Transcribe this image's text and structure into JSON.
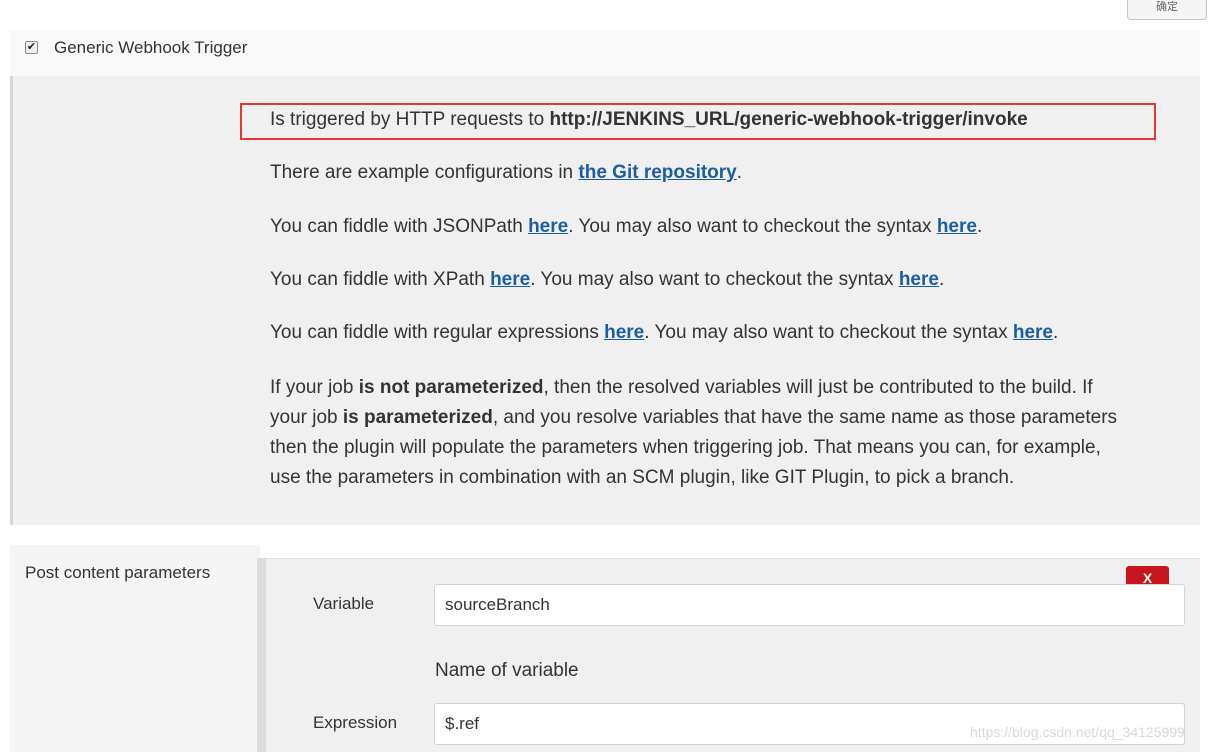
{
  "top_button": {
    "label": "确定"
  },
  "trigger": {
    "checked": true,
    "label": "Generic Webhook Trigger"
  },
  "help": {
    "url_prefix": "Is triggered by HTTP requests to ",
    "url": "http://JENKINS_URL/generic-webhook-trigger/invoke",
    "examples_prefix": "There are example configurations in ",
    "examples_link": "the Git repository",
    "examples_suffix": ".",
    "jsonpath_prefix": "You can fiddle with JSONPath ",
    "jsonpath_link": "here",
    "jsonpath_middle": ". You may also want to checkout the syntax ",
    "jsonpath_syntax_link": "here",
    "jsonpath_suffix": ".",
    "xpath_prefix": "You can fiddle with XPath ",
    "xpath_link": "here",
    "xpath_middle": ". You may also want to checkout the syntax ",
    "xpath_syntax_link": "here",
    "xpath_suffix": ".",
    "regex_prefix": "You can fiddle with regular expressions ",
    "regex_link": "here",
    "regex_middle": ". You may also want to checkout the syntax ",
    "regex_syntax_link": "here",
    "regex_suffix": ".",
    "param_line1_a": "If your job ",
    "param_line1_bold": "is not parameterized",
    "param_line1_b": ", then the resolved variables will just be contributed to the build. If",
    "param_line2_a": "your job ",
    "param_line2_bold": "is parameterized",
    "param_line2_b": ", and you resolve variables that have the same name as those parameters",
    "param_line3": "then the plugin will populate the parameters when triggering job. That means you can, for example,",
    "param_line4": "use the parameters in combination with an SCM plugin, like GIT Plugin, to pick a branch."
  },
  "post_content": {
    "section_label": "Post content parameters",
    "delete_label": "X",
    "variable_label": "Variable",
    "variable_value": "sourceBranch",
    "variable_help": "Name of variable",
    "expression_label": "Expression",
    "expression_value": "$.ref"
  },
  "watermark": "https://blog.csdn.net/qq_34125999",
  "colors": {
    "link": "#1b5fa0",
    "highlight_border": "#e53935",
    "delete_button": "#c4161c"
  }
}
